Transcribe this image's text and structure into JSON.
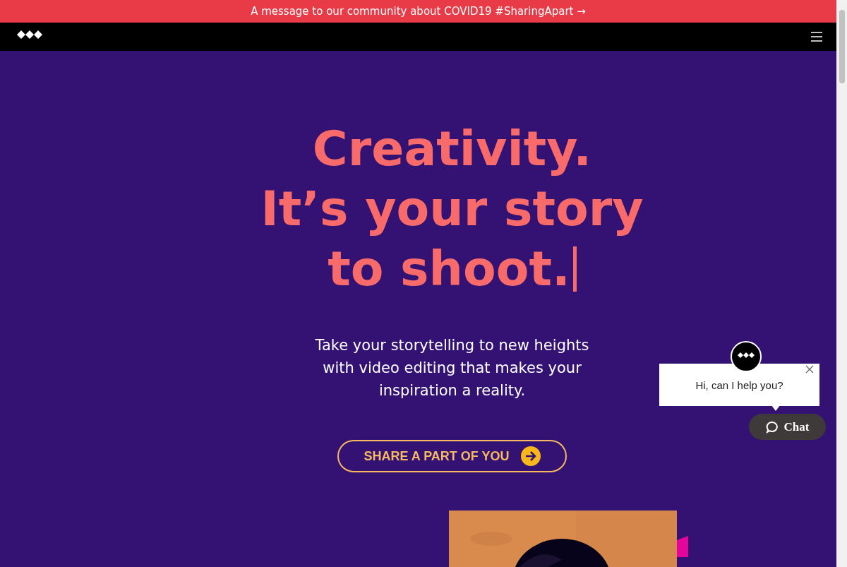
{
  "banner": {
    "text": "A message to our community about COVID19 #SharingApart →"
  },
  "hero": {
    "headline": [
      "Creativity.",
      "It’s your story",
      "to shoot."
    ],
    "subtitle": "Take your storytelling to new heights with video editing that makes your inspiration a reality.",
    "cta": "SHARE A PART OF YOU"
  },
  "chat": {
    "greeting": "Hi, can I help you?",
    "button": "Chat"
  }
}
